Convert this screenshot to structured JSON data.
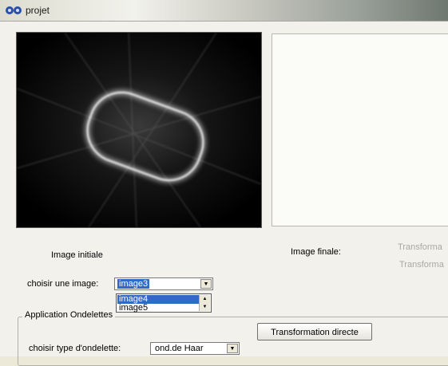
{
  "window": {
    "title": "projet"
  },
  "labels": {
    "image_initiale": "Image initiale",
    "image_finale": "Image finale:",
    "transform_1": "Transforma",
    "transform_2": "Transforma",
    "choisir_image": "choisir une image:",
    "choisir_ondelette": "choisir type d'ondelette:"
  },
  "image_select": {
    "value": "image3",
    "options": [
      "image4",
      "image5"
    ],
    "highlighted": "image4"
  },
  "ondelette_select": {
    "value": "ond.de Haar"
  },
  "group": {
    "title": "Application Ondelettes"
  },
  "buttons": {
    "transformation_directe": "Transformation directe"
  },
  "colors": {
    "selection": "#3169c6",
    "window_bg": "#f2f1eb"
  },
  "icons": {
    "app": "app-logo-icon",
    "combo_arrow": "chevron-down-icon"
  }
}
